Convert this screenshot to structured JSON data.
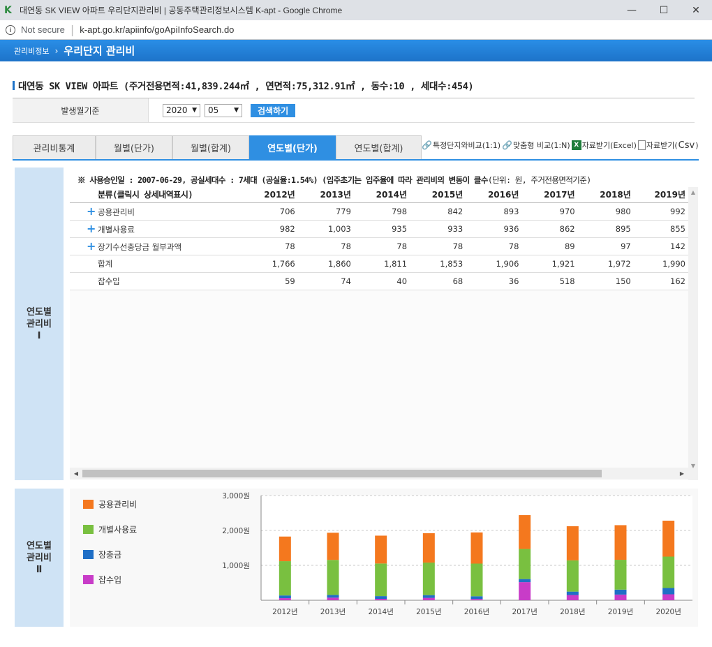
{
  "browser": {
    "logo": "K",
    "title": "대연동 SK VIEW 아파트 우리단지관리비 | 공동주택관리정보시스템 K-apt - Google Chrome",
    "not_secure": "Not secure",
    "url": "k-apt.go.kr/apiinfo/goApiInfoSearch.do"
  },
  "header": {
    "crumb_parent": "관리비정보",
    "crumb_current": "우리단지 관리비"
  },
  "apartment": {
    "title": "대연동 SK VIEW 아파트 (주거전용면적:41,839.244㎡ , 연면적:75,312.91㎡ , 동수:10 , 세대수:454)"
  },
  "filter": {
    "label": "발생월기준",
    "year": "2020",
    "month": "05",
    "search_label": "검색하기"
  },
  "tabs": [
    {
      "label": "관리비통계",
      "active": false
    },
    {
      "label": "월별(단가)",
      "active": false
    },
    {
      "label": "월별(합계)",
      "active": false
    },
    {
      "label": "연도별(단가)",
      "active": true
    },
    {
      "label": "연도별(합계)",
      "active": false
    }
  ],
  "tab_links": {
    "compare_1to1": "특정단지와비교(1:1)",
    "compare_1toN": "맞춤형 비교(1:N)",
    "excel": "자료받기(Excel)",
    "csv_prefix": "자료받기(",
    "csv": "Csv",
    "csv_suffix": ")"
  },
  "section1": {
    "side_label": [
      "연도별",
      "관리비",
      "Ⅰ"
    ],
    "notice_prefix": "※ 사용승인일 : 2007-06-29, 공실세대수 : 7세대 (공실율:1.54%) (입주초기는 입주율에 따라 관리비의 변동이 클수",
    "notice_suffix": "(단위: 원, 주거전용면적기준)",
    "table": {
      "category_header": "분류(클릭시 상세내역표시)",
      "years": [
        "2012년",
        "2013년",
        "2014년",
        "2015년",
        "2016년",
        "2017년",
        "2018년",
        "2019년"
      ],
      "rows": [
        {
          "label": "공용관리비",
          "expandable": true,
          "values": [
            "706",
            "779",
            "798",
            "842",
            "893",
            "970",
            "980",
            "992"
          ]
        },
        {
          "label": "개별사용료",
          "expandable": true,
          "values": [
            "982",
            "1,003",
            "935",
            "933",
            "936",
            "862",
            "895",
            "855"
          ]
        },
        {
          "label": "장기수선충당금 월부과액",
          "expandable": true,
          "values": [
            "78",
            "78",
            "78",
            "78",
            "78",
            "89",
            "97",
            "142"
          ]
        },
        {
          "label": "합계",
          "expandable": false,
          "values": [
            "1,766",
            "1,860",
            "1,811",
            "1,853",
            "1,906",
            "1,921",
            "1,972",
            "1,990"
          ]
        },
        {
          "label": "잡수입",
          "expandable": false,
          "values": [
            "59",
            "74",
            "40",
            "68",
            "36",
            "518",
            "150",
            "162"
          ]
        }
      ]
    }
  },
  "section2": {
    "side_label": [
      "연도별",
      "관리비",
      "Ⅱ"
    ]
  },
  "chart_data": {
    "type": "bar",
    "stacked": true,
    "categories": [
      "2012년",
      "2013년",
      "2014년",
      "2015년",
      "2016년",
      "2017년",
      "2018년",
      "2019년",
      "2020년"
    ],
    "series": [
      {
        "name": "잡수입",
        "color": "#c83cc8",
        "values": [
          59,
          74,
          40,
          68,
          36,
          518,
          150,
          162,
          170
        ]
      },
      {
        "name": "장충금",
        "color": "#1f6fc6",
        "values": [
          78,
          78,
          78,
          78,
          78,
          89,
          97,
          142,
          180
        ]
      },
      {
        "name": "개별사용료",
        "color": "#79c040",
        "values": [
          982,
          1003,
          935,
          933,
          936,
          862,
          895,
          855,
          900
        ]
      },
      {
        "name": "공용관리비",
        "color": "#f4781e",
        "values": [
          706,
          779,
          798,
          842,
          893,
          970,
          980,
          992,
          1030
        ]
      }
    ],
    "legend_order": [
      "공용관리비",
      "개별사용료",
      "장충금",
      "잡수입"
    ],
    "ylim": [
      0,
      3000
    ],
    "yticks": [
      {
        "value": 1000,
        "label": "1,000원"
      },
      {
        "value": 2000,
        "label": "2,000원"
      },
      {
        "value": 3000,
        "label": "3,000원"
      }
    ],
    "grid": true,
    "legend_position": "left"
  }
}
